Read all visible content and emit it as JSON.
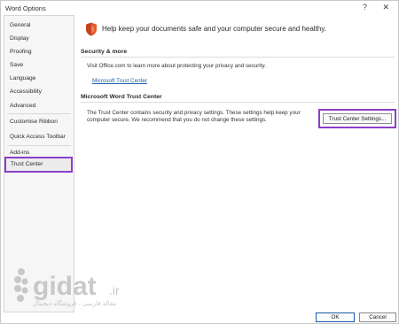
{
  "window": {
    "title": "Word Options",
    "help_glyph": "?",
    "close_glyph": "✕"
  },
  "sidebar": {
    "items": [
      {
        "label": "General"
      },
      {
        "label": "Display"
      },
      {
        "label": "Proofing"
      },
      {
        "label": "Save"
      },
      {
        "label": "Language"
      },
      {
        "label": "Accessibility"
      },
      {
        "label": "Advanced"
      },
      {
        "label": "Customise Ribbon"
      },
      {
        "label": "Quick Access Toolbar"
      },
      {
        "label": "Add-ins"
      },
      {
        "label": "Trust Center"
      }
    ],
    "selected": "Trust Center"
  },
  "main": {
    "hero_text": "Help keep your documents safe and your computer secure and healthy.",
    "security_heading": "Security & more",
    "security_text": "Visit Office.com to learn more about protecting your privacy and security.",
    "security_link": "Microsoft Trust Center",
    "trust_heading": "Microsoft Word Trust Center",
    "trust_text_line1": "The Trust Center contains security and privacy settings. These settings help keep your",
    "trust_text_line2": "computer secure. We recommend that you do not change these settings.",
    "trust_button": "Trust Center Settings..."
  },
  "footer": {
    "ok_label": "OK",
    "cancel_label": "Cancel"
  },
  "watermark": {
    "brand_text": "gidat",
    "tld_text": ".ir",
    "tagline": "مقاله فارسی ، فروشگاه دیجیتال"
  },
  "colors": {
    "highlight": "#8a3fc7",
    "link": "#1a5ca8",
    "shield_orange": "#e2572b"
  },
  "icons": {
    "shield": "shield-icon"
  }
}
